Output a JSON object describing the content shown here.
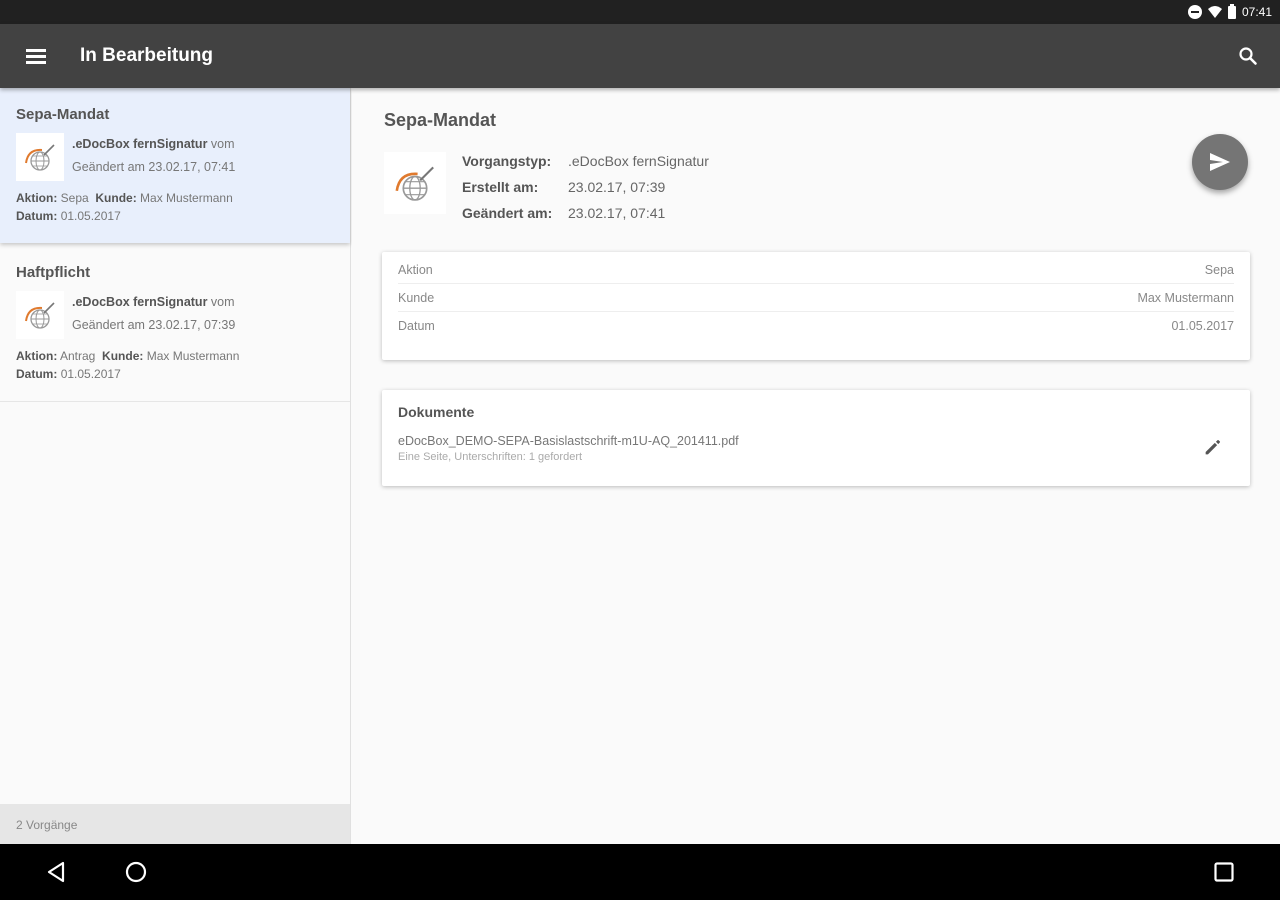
{
  "status_bar": {
    "time": "07:41"
  },
  "app_bar": {
    "title": "In Bearbeitung"
  },
  "list": {
    "items": [
      {
        "title": "Sepa-Mandat",
        "type_name": ".eDocBox fernSignatur",
        "type_suffix": " vom",
        "changed": "Geändert am 23.02.17, 07:41",
        "aktion_label": "Aktion:",
        "aktion_value": "Sepa",
        "kunde_label": "Kunde:",
        "kunde_value": "Max Mustermann",
        "datum_label": "Datum:",
        "datum_value": "01.05.2017",
        "selected": true
      },
      {
        "title": "Haftpflicht",
        "type_name": ".eDocBox fernSignatur",
        "type_suffix": " vom",
        "changed": "Geändert am 23.02.17, 07:39",
        "aktion_label": "Aktion:",
        "aktion_value": "Antrag",
        "kunde_label": "Kunde:",
        "kunde_value": "Max Mustermann",
        "datum_label": "Datum:",
        "datum_value": "01.05.2017",
        "selected": false
      }
    ],
    "footer": "2 Vorgänge"
  },
  "detail": {
    "title": "Sepa-Mandat",
    "info": [
      {
        "label": "Vorgangstyp:",
        "value": ".eDocBox fernSignatur"
      },
      {
        "label": "Erstellt am:",
        "value": "23.02.17, 07:39"
      },
      {
        "label": "Geändert am:",
        "value": "23.02.17, 07:41"
      }
    ],
    "properties": [
      {
        "label": "Aktion",
        "value": "Sepa"
      },
      {
        "label": "Kunde",
        "value": "Max Mustermann"
      },
      {
        "label": "Datum",
        "value": "01.05.2017"
      }
    ],
    "documents": {
      "title": "Dokumente",
      "file_name": "eDocBox_DEMO-SEPA-Basislastschrift-m1U-AQ_201411.pdf",
      "file_info": "Eine Seite, Unterschriften: 1 gefordert"
    }
  },
  "icons": {
    "menu": "hamburger-menu-icon",
    "search": "search-icon",
    "send": "send-icon",
    "edit": "pencil-icon",
    "doc_thumb": "edocbox-globe-icon",
    "nav_back": "triangle-back-icon",
    "nav_home": "circle-home-icon",
    "nav_recent": "square-recents-icon"
  },
  "colors": {
    "app_bar": "#424242",
    "selected_item": "#e8effc",
    "fab": "#757575",
    "logo_accent": "#e07a2e"
  }
}
